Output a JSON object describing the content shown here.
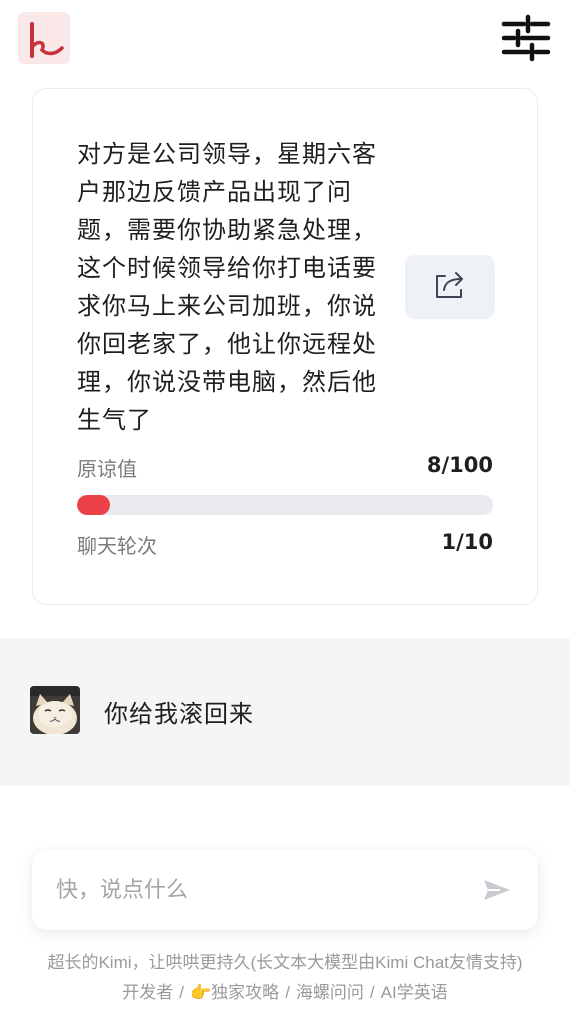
{
  "header": {
    "logo_icon": "kimi-k-logo",
    "settings_icon": "sliders-icon"
  },
  "scenario": {
    "text": "对方是公司领导，星期六客户那边反馈产品出现了问题，需要你协助紧急处理，这个时候领导给你打电话要求你马上来公司加班，你说你回老家了，他让你远程处理，你说没带电脑，然后他生气了",
    "share_icon": "share-icon"
  },
  "metrics": {
    "forgiveness_label": "原谅值",
    "forgiveness_value": "8/100",
    "forgiveness_fraction": 0.08,
    "rounds_label": "聊天轮次",
    "rounds_value": "1/10"
  },
  "chat": {
    "messages": [
      {
        "avatar_icon": "cat-avatar",
        "text": "你给我滚回来"
      }
    ]
  },
  "composer": {
    "placeholder": "快，说点什么",
    "value": "",
    "send_icon": "send-icon"
  },
  "footer": {
    "line1": "超长的Kimi，让哄哄更持久(长文本大模型由Kimi Chat友情支持)",
    "links": [
      "开发者",
      "👉独家攻略",
      "海螺问问",
      "AI学英语"
    ],
    "separator": "/"
  },
  "colors": {
    "accent": "#ea4246",
    "track": "#e9eaee",
    "chat_bg": "#f4f5f7",
    "share_bg": "#eef2f7"
  }
}
